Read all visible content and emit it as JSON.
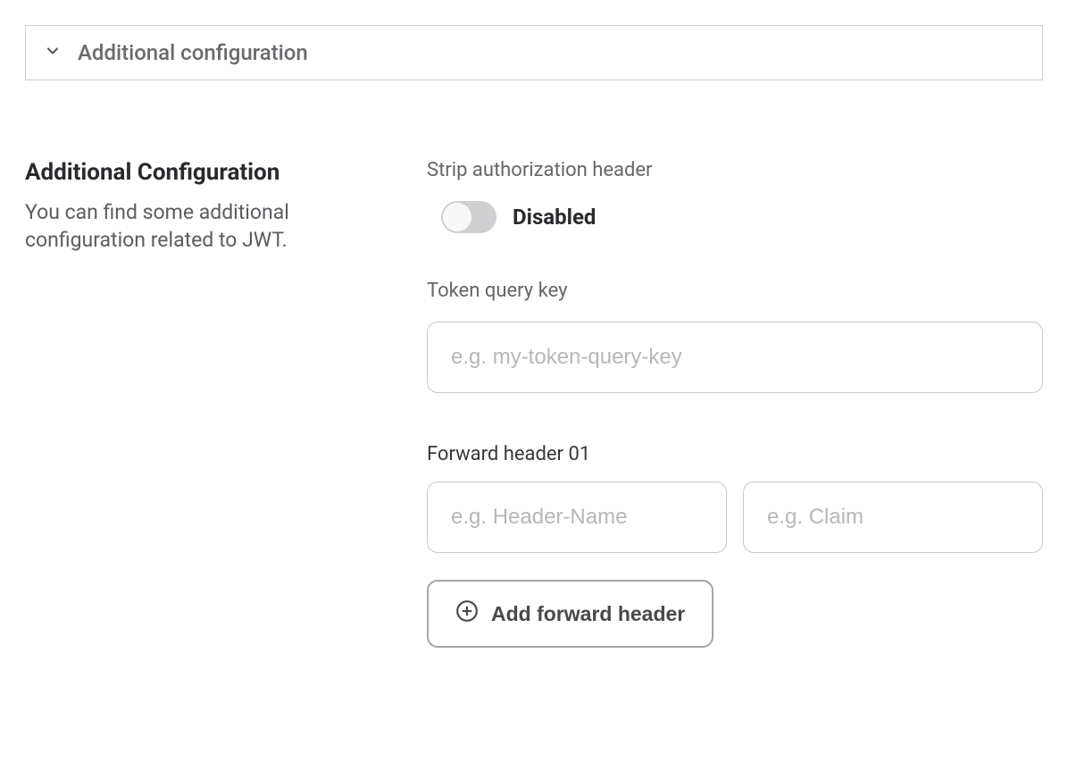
{
  "accordion": {
    "title": "Additional configuration"
  },
  "left": {
    "heading": "Additional Configuration",
    "description": "You can find some additional configuration related to JWT."
  },
  "strip": {
    "label": "Strip authorization header",
    "status": "Disabled"
  },
  "token": {
    "label": "Token query key",
    "placeholder": "e.g. my-token-query-key",
    "value": ""
  },
  "forward": {
    "label": "Forward header 01",
    "name_placeholder": "e.g. Header-Name",
    "name_value": "",
    "claim_placeholder": "e.g. Claim",
    "claim_value": ""
  },
  "add_button": {
    "label": "Add forward header"
  }
}
